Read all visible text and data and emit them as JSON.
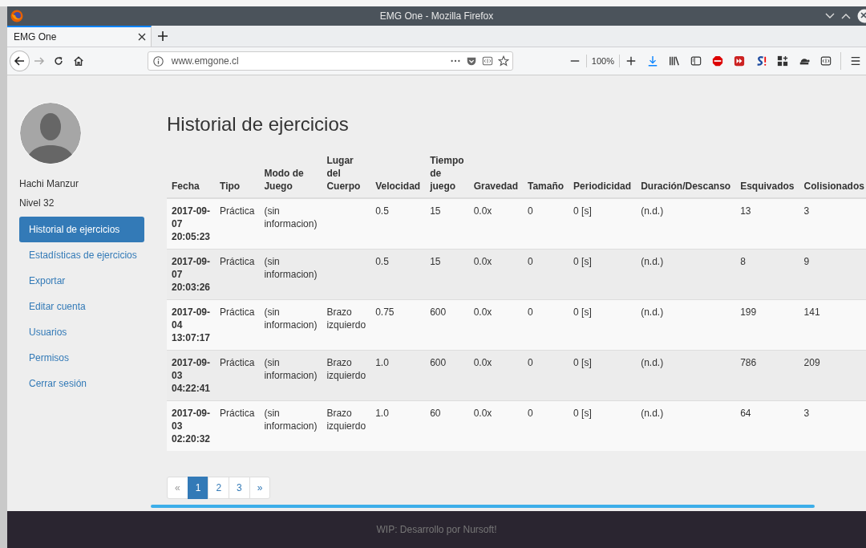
{
  "window": {
    "title": "EMG One - Mozilla Firefox"
  },
  "tabs": [
    {
      "label": "EMG One",
      "selected": true
    }
  ],
  "address_bar": {
    "value": "www.emgone.cl"
  },
  "zoom": "100%",
  "sidebar": {
    "user_name": "Hachi Manzur",
    "level_text": "Nivel 32",
    "items": [
      {
        "label": "Historial de ejercicios",
        "selected": true
      },
      {
        "label": "Estadísticas de ejercicios",
        "selected": false
      },
      {
        "label": "Exportar",
        "selected": false
      },
      {
        "label": "Editar cuenta",
        "selected": false
      },
      {
        "label": "Usuarios",
        "selected": false
      },
      {
        "label": "Permisos",
        "selected": false
      },
      {
        "label": "Cerrar sesión",
        "selected": false
      }
    ]
  },
  "main": {
    "title": "Historial de ejercicios",
    "table": {
      "columns": [
        "Fecha",
        "Tipo",
        "Modo de Juego",
        "Lugar del Cuerpo",
        "Velocidad",
        "Tiempo de juego",
        "Gravedad",
        "Tamaño",
        "Periodicidad",
        "Duración/Descanso",
        "Esquivados",
        "Colisionados"
      ],
      "rows": [
        [
          "2017-09-07 20:05:23",
          "Práctica",
          "(sin informacion)",
          null,
          "0.5",
          "15",
          "0.0x",
          "0",
          "0 [s]",
          "(n.d.)",
          "13",
          "3"
        ],
        [
          "2017-09-07 20:03:26",
          "Práctica",
          "(sin informacion)",
          null,
          "0.5",
          "15",
          "0.0x",
          "0",
          "0 [s]",
          "(n.d.)",
          "8",
          "9"
        ],
        [
          "2017-09-04 13:07:17",
          "Práctica",
          "(sin informacion)",
          "Brazo izquierdo",
          "0.75",
          "600",
          "0.0x",
          "0",
          "0 [s]",
          "(n.d.)",
          "199",
          "141"
        ],
        [
          "2017-09-03 04:22:41",
          "Práctica",
          "(sin informacion)",
          "Brazo izquierdo",
          "1.0",
          "600",
          "0.0x",
          "0",
          "0 [s]",
          "(n.d.)",
          "786",
          "209"
        ],
        [
          "2017-09-03 02:20:32",
          "Práctica",
          "(sin informacion)",
          "Brazo izquierdo",
          "1.0",
          "60",
          "0.0x",
          "0",
          "0 [s]",
          "(n.d.)",
          "64",
          "3"
        ]
      ]
    },
    "pagination": [
      {
        "label": "«",
        "selected": false
      },
      {
        "label": "1",
        "selected": true
      },
      {
        "label": "2",
        "selected": false
      },
      {
        "label": "3",
        "selected": false
      },
      {
        "label": "»",
        "selected": false
      }
    ]
  },
  "footer": {
    "text": "WIP: Desarrollo por Nursoft!"
  }
}
